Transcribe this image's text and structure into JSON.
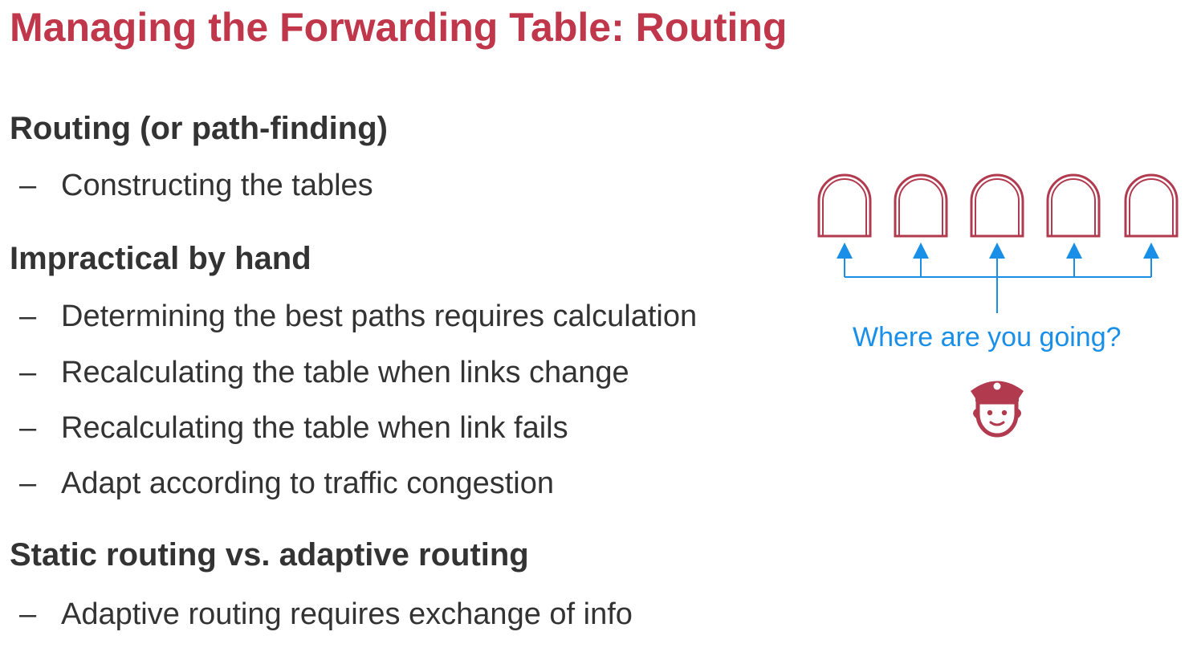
{
  "slide": {
    "title": "Managing the Forwarding Table: Routing",
    "sections": [
      {
        "heading": "Routing (or path-finding)",
        "bullets": [
          "Constructing the tables"
        ]
      },
      {
        "heading": "Impractical by hand",
        "bullets": [
          "Determining the best paths requires calculation",
          "Recalculating the table when links change",
          "Recalculating the table when link fails",
          "Adapt according to traffic congestion"
        ]
      },
      {
        "heading": "Static routing vs. adaptive routing",
        "bullets": [
          "Adaptive routing requires exchange of info"
        ]
      }
    ],
    "bullet_marker": "–"
  },
  "diagram": {
    "gates": [
      "gate-icon",
      "gate-icon",
      "gate-icon",
      "gate-icon",
      "gate-icon"
    ],
    "question": "Where are you going?",
    "officer_icon": "police-officer-icon",
    "colors": {
      "gate": "#b23a4f",
      "arrow": "#1a8fe8",
      "officer": "#b23a4f"
    }
  }
}
